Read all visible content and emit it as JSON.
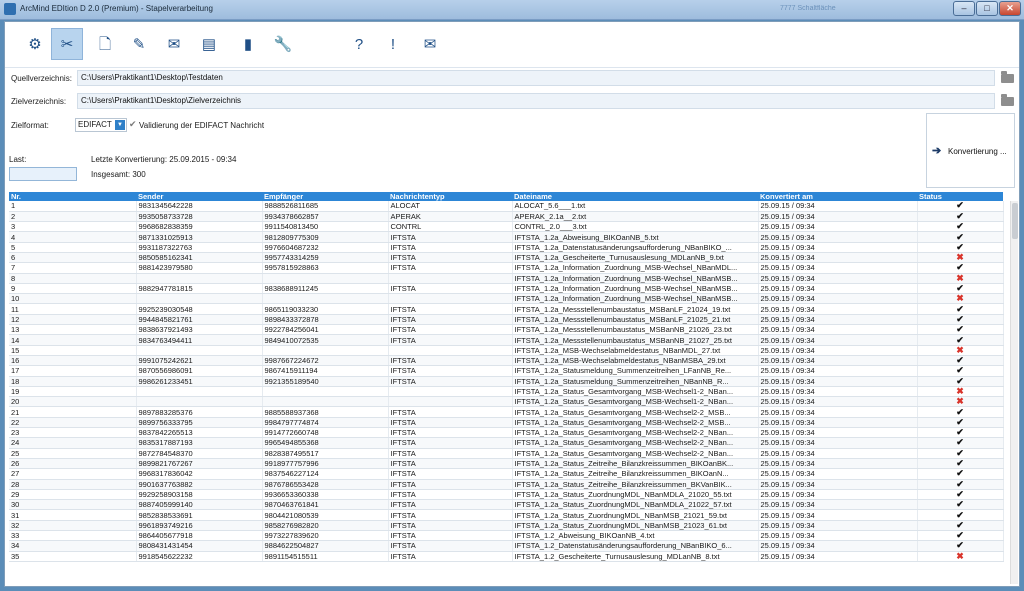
{
  "window": {
    "title": "ArcMind EDItion D 2.0 (Premium) - Stapelverarbeitung",
    "ghost_text": "7777 Schaltfläche"
  },
  "toolbar": {
    "tools": [
      {
        "icon": "settings-person-icon",
        "glyph": "⚙"
      },
      {
        "icon": "batch-tools-icon",
        "glyph": "✂"
      },
      {
        "icon": "new-document-icon",
        "glyph": "🗋"
      },
      {
        "icon": "edit-document-icon",
        "glyph": "✎"
      },
      {
        "icon": "mail-document-icon",
        "glyph": "✉"
      },
      {
        "icon": "stack-icon",
        "glyph": "▤"
      },
      {
        "icon": "device-icon",
        "glyph": "▮"
      },
      {
        "icon": "wrench-icon",
        "glyph": "🔧"
      },
      {
        "icon": "help-search-icon",
        "glyph": "?"
      },
      {
        "icon": "info-exclaim-icon",
        "glyph": "!"
      },
      {
        "icon": "mail-send-icon",
        "glyph": "✉"
      }
    ]
  },
  "form": {
    "source_label": "Quellverzeichnis:",
    "source_path": "C:\\Users\\Praktikant1\\Desktop\\Testdaten",
    "target_label": "Zielverzeichnis:",
    "target_path": "C:\\Users\\Praktikant1\\Desktop\\Zielverzeichnis",
    "format_label": "Zielformat:",
    "format_value": "EDIFACT",
    "validate_label": "Validierung der EDIFACT Nachricht",
    "convert_label": "Konvertierung ..."
  },
  "status": {
    "last_label": "Last:",
    "last_conversion": "Letzte Konvertierung: 25.09.2015 - 09:34",
    "total": "Insgesamt: 300"
  },
  "table": {
    "headers": [
      "Nr.",
      "Sender",
      "Empfänger",
      "Nachrichtentyp",
      "Dateiname",
      "Konvertiert am",
      "Status"
    ],
    "rows": [
      [
        "1",
        "9831345642228",
        "9888526811685",
        "ALOCAT",
        "ALOCAT_5.6___1.txt",
        "25.09.15 / 09:34",
        "ok"
      ],
      [
        "2",
        "9935058733728",
        "9934378662857",
        "APERAK",
        "APERAK_2.1a__2.txt",
        "25.09.15 / 09:34",
        "ok"
      ],
      [
        "3",
        "9968682838359",
        "9911540813450",
        "CONTRL",
        "CONTRL_2.0___3.txt",
        "25.09.15 / 09:34",
        "ok"
      ],
      [
        "4",
        "9871331025913",
        "9812809775309",
        "IFTSTA",
        "IFTSTA_1.2a_Abweisung_BIKOanNB_5.txt",
        "25.09.15 / 09:34",
        "ok"
      ],
      [
        "5",
        "9931187322763",
        "9976604687232",
        "IFTSTA",
        "IFTSTA_1.2a_Datenstatusänderungsaufforderung_NBanBIKO_...",
        "25.09.15 / 09:34",
        "ok"
      ],
      [
        "6",
        "9850585162341",
        "9957743314259",
        "IFTSTA",
        "IFTSTA_1.2a_Gescheiterte_Turnusauslesung_MDLanNB_9.txt",
        "25.09.15 / 09:34",
        "err"
      ],
      [
        "7",
        "9881423979580",
        "9957815928863",
        "IFTSTA",
        "IFTSTA_1.2a_Information_Zuordnung_MSB-Wechsel_NBanMDL...",
        "25.09.15 / 09:34",
        "ok"
      ],
      [
        "8",
        "",
        "",
        "",
        "IFTSTA_1.2a_Information_Zuordnung_MSB-Wechsel_NBanMSB...",
        "25.09.15 / 09:34",
        "err"
      ],
      [
        "9",
        "9882947781815",
        "9838688911245",
        "IFTSTA",
        "IFTSTA_1.2a_Information_Zuordnung_MSB-Wechsel_NBanMSB...",
        "25.09.15 / 09:34",
        "ok"
      ],
      [
        "10",
        "",
        "",
        "",
        "IFTSTA_1.2a_Information_Zuordnung_MSB-Wechsel_NBanMSB...",
        "25.09.15 / 09:34",
        "err"
      ],
      [
        "11",
        "9925239030548",
        "9865119033230",
        "IFTSTA",
        "IFTSTA_1.2a_Messstellenumbaustatus_MSBanLF_21024_19.txt",
        "25.09.15 / 09:34",
        "ok"
      ],
      [
        "12",
        "9944845821761",
        "9898433372878",
        "IFTSTA",
        "IFTSTA_1.2a_Messstellenumbaustatus_MSBanLF_21025_21.txt",
        "25.09.15 / 09:34",
        "ok"
      ],
      [
        "13",
        "9838637921493",
        "9922784256041",
        "IFTSTA",
        "IFTSTA_1.2a_Messstellenumbaustatus_MSBanNB_21026_23.txt",
        "25.09.15 / 09:34",
        "ok"
      ],
      [
        "14",
        "9834763494411",
        "9849410072535",
        "IFTSTA",
        "IFTSTA_1.2a_Messstellenumbaustatus_MSBanNB_21027_25.txt",
        "25.09.15 / 09:34",
        "ok"
      ],
      [
        "15",
        "",
        "",
        "",
        "IFTSTA_1.2a_MSB-Wechselabmeldestatus_NBanMDL_27.txt",
        "25.09.15 / 09:34",
        "err"
      ],
      [
        "16",
        "9991075242621",
        "9987667224672",
        "IFTSTA",
        "IFTSTA_1.2a_MSB-Wechselabmeldestatus_NBanMSBA_29.txt",
        "25.09.15 / 09:34",
        "ok"
      ],
      [
        "17",
        "9870556986091",
        "9867415911194",
        "IFTSTA",
        "IFTSTA_1.2a_Statusmeldung_Summenzeitreihen_LFanNB_Re...",
        "25.09.15 / 09:34",
        "ok"
      ],
      [
        "18",
        "9986261233451",
        "9921355189540",
        "IFTSTA",
        "IFTSTA_1.2a_Statusmeldung_Summenzeitreihen_NBanNB_R...",
        "25.09.15 / 09:34",
        "ok"
      ],
      [
        "19",
        "",
        "",
        "",
        "IFTSTA_1.2a_Status_Gesamtvorgang_MSB-Wechsel1-2_NBan...",
        "25.09.15 / 09:34",
        "err"
      ],
      [
        "20",
        "",
        "",
        "",
        "IFTSTA_1.2a_Status_Gesamtvorgang_MSB-Wechsel1-2_NBan...",
        "25.09.15 / 09:34",
        "err"
      ],
      [
        "21",
        "9897883285376",
        "9885588937368",
        "IFTSTA",
        "IFTSTA_1.2a_Status_Gesamtvorgang_MSB-Wechsel2-2_MSB...",
        "25.09.15 / 09:34",
        "ok"
      ],
      [
        "22",
        "9899756333795",
        "9984797774874",
        "IFTSTA",
        "IFTSTA_1.2a_Status_Gesamtvorgang_MSB-Wechsel2-2_MSB...",
        "25.09.15 / 09:34",
        "ok"
      ],
      [
        "23",
        "9837842265513",
        "9914772660748",
        "IFTSTA",
        "IFTSTA_1.2a_Status_Gesamtvorgang_MSB-Wechsel2-2_NBan...",
        "25.09.15 / 09:34",
        "ok"
      ],
      [
        "24",
        "9835317887193",
        "9965494855368",
        "IFTSTA",
        "IFTSTA_1.2a_Status_Gesamtvorgang_MSB-Wechsel2-2_NBan...",
        "25.09.15 / 09:34",
        "ok"
      ],
      [
        "25",
        "9872784548370",
        "9828387495517",
        "IFTSTA",
        "IFTSTA_1.2a_Status_Gesamtvorgang_MSB-Wechsel2-2_NBan...",
        "25.09.15 / 09:34",
        "ok"
      ],
      [
        "26",
        "9899821767267",
        "9918977757996",
        "IFTSTA",
        "IFTSTA_1.2a_Status_Zeitreihe_Bilanzkreissummen_BIKOanBK...",
        "25.09.15 / 09:34",
        "ok"
      ],
      [
        "27",
        "9968317836042",
        "9837546227124",
        "IFTSTA",
        "IFTSTA_1.2a_Status_Zeitreihe_Bilanzkreissummen_BIKOanN...",
        "25.09.15 / 09:34",
        "ok"
      ],
      [
        "28",
        "9901637763882",
        "9876786553428",
        "IFTSTA",
        "IFTSTA_1.2a_Status_Zeitreihe_Bilanzkreissummen_BKVanBIK...",
        "25.09.15 / 09:34",
        "ok"
      ],
      [
        "29",
        "9929258903158",
        "9936653360338",
        "IFTSTA",
        "IFTSTA_1.2a_Status_ZuordnungMDL_NBanMDLA_21020_55.txt",
        "25.09.15 / 09:34",
        "ok"
      ],
      [
        "30",
        "9887405999140",
        "9870463761841",
        "IFTSTA",
        "IFTSTA_1.2a_Status_ZuordnungMDL_NBanMDLA_21022_57.txt",
        "25.09.15 / 09:34",
        "ok"
      ],
      [
        "31",
        "9852838533691",
        "9804421080539",
        "IFTSTA",
        "IFTSTA_1.2a_Status_ZuordnungMDL_NBanMSB_21021_59.txt",
        "25.09.15 / 09:34",
        "ok"
      ],
      [
        "32",
        "9961893749216",
        "9858276982820",
        "IFTSTA",
        "IFTSTA_1.2a_Status_ZuordnungMDL_NBanMSB_21023_61.txt",
        "25.09.15 / 09:34",
        "ok"
      ],
      [
        "33",
        "9864405677918",
        "9973227839620",
        "IFTSTA",
        "IFTSTA_1.2_Abweisung_BIKOanNB_4.txt",
        "25.09.15 / 09:34",
        "ok"
      ],
      [
        "34",
        "9808431431454",
        "9884622504827",
        "IFTSTA",
        "IFTSTA_1.2_Datenstatusänderungsaufforderung_NBanBIKO_6...",
        "25.09.15 / 09:34",
        "ok"
      ],
      [
        "35",
        "9918545622232",
        "9891154515511",
        "IFTSTA",
        "IFTSTA_1.2_Gescheiterte_Turnusauslesung_MDLanNB_8.txt",
        "25.09.15 / 09:34",
        "err"
      ]
    ]
  }
}
